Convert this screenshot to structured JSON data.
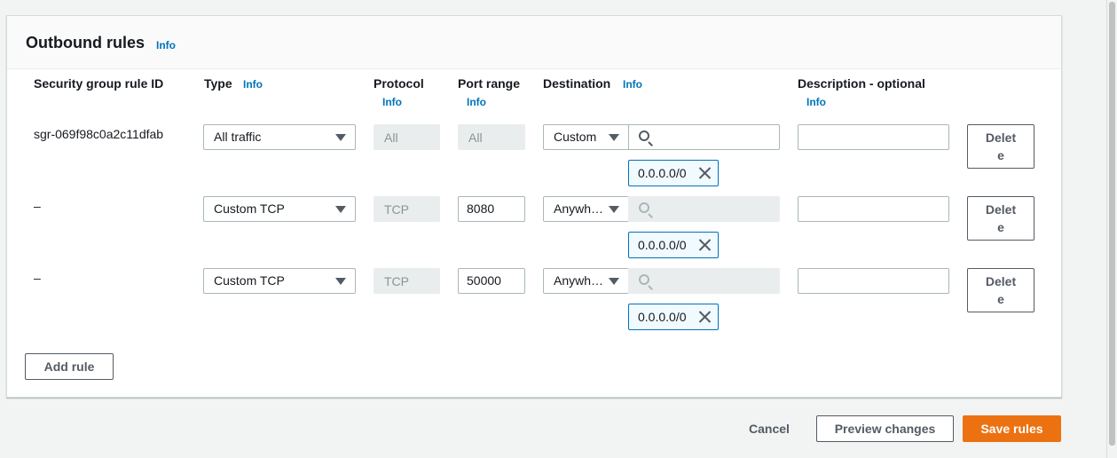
{
  "section": {
    "title": "Outbound rules",
    "title_info": "Info"
  },
  "columns": {
    "rule_id": "Security group rule ID",
    "type": "Type",
    "type_info": "Info",
    "protocol": "Protocol",
    "protocol_info": "Info",
    "port_range": "Port range",
    "port_range_info": "Info",
    "destination": "Destination",
    "destination_info": "Info",
    "description": "Description - optional",
    "description_info": "Info"
  },
  "rules": [
    {
      "rule_id": "sgr-069f98c0a2c11dfab",
      "type": "All traffic",
      "protocol": "All",
      "port_range": "All",
      "port_editable": false,
      "destination_type": "Custom",
      "search_value": "",
      "token": "0.0.0.0/0",
      "description": "",
      "delete_label": "Delete"
    },
    {
      "rule_id": "–",
      "type": "Custom TCP",
      "protocol": "TCP",
      "port_range": "8080",
      "port_editable": true,
      "destination_type": "Anywh…",
      "search_value": "",
      "token": "0.0.0.0/0",
      "description": "",
      "delete_label": "Delete"
    },
    {
      "rule_id": "–",
      "type": "Custom TCP",
      "protocol": "TCP",
      "port_range": "50000",
      "port_editable": true,
      "destination_type": "Anywh…",
      "search_value": "",
      "token": "0.0.0.0/0",
      "description": "",
      "delete_label": "Delete"
    }
  ],
  "add_rule_label": "Add rule",
  "footer": {
    "cancel_label": "Cancel",
    "preview_label": "Preview changes",
    "save_label": "Save rules"
  },
  "icons": {
    "search": "search-icon",
    "dropdown": "caret-down-icon",
    "remove": "close-icon"
  },
  "colors": {
    "accent_link": "#0073bb",
    "primary_button": "#ec7211",
    "token_border": "#0073bb",
    "token_bg": "#f1faff"
  }
}
